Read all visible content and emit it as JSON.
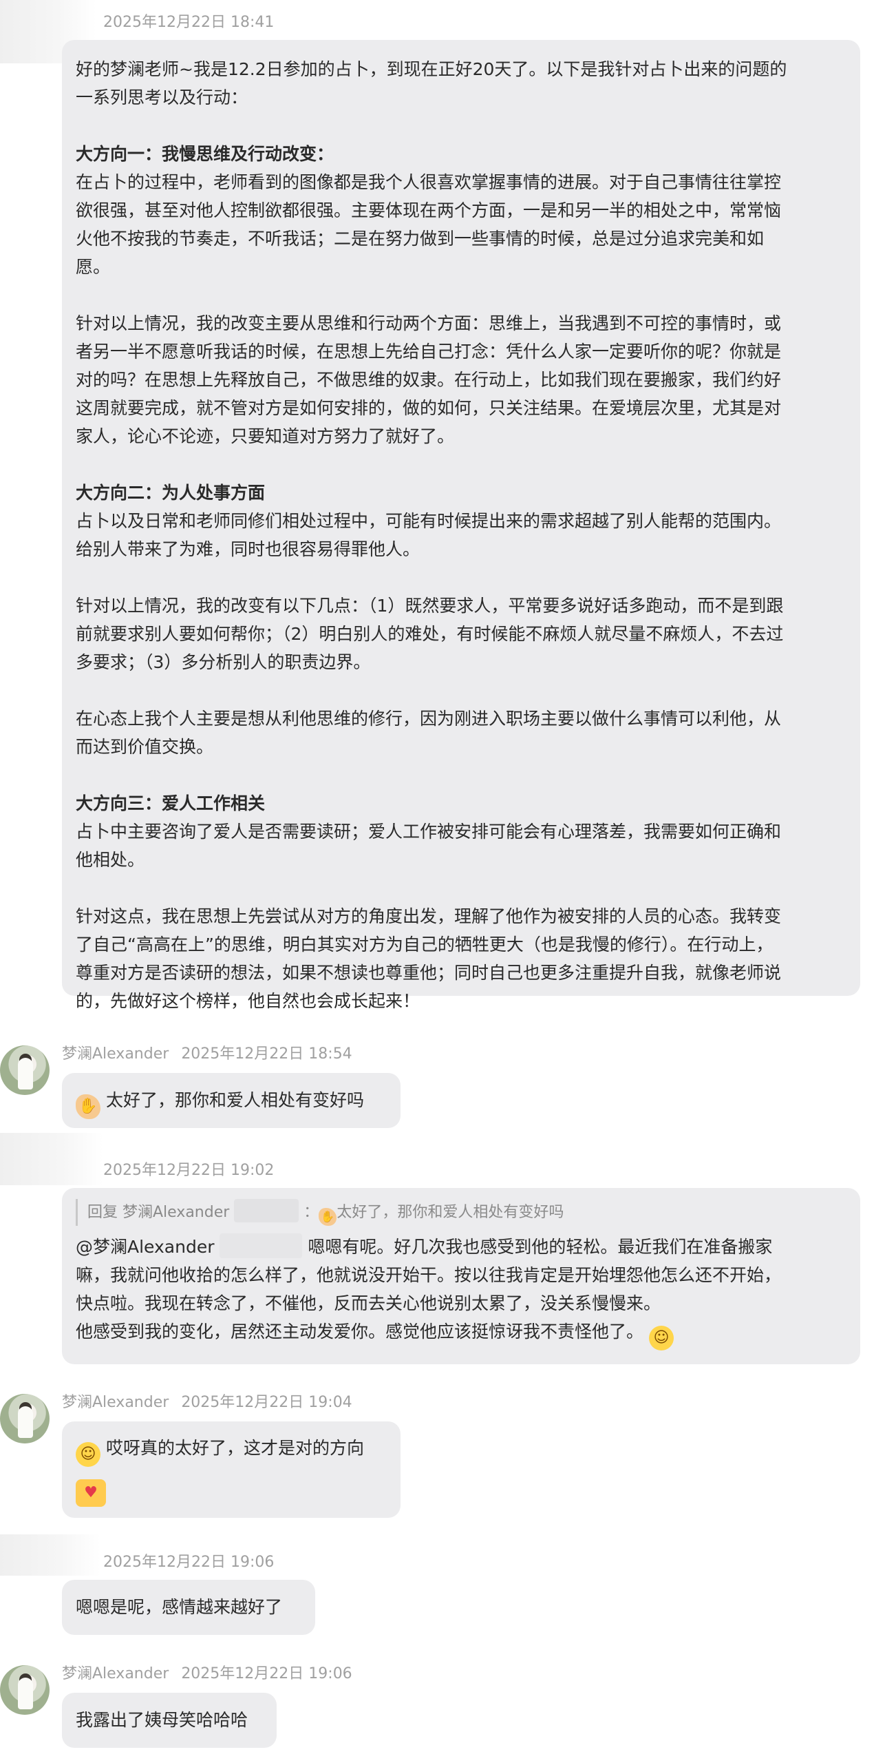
{
  "messages": [
    {
      "time": "2025年12月22日 18:41",
      "heading1_text": "好的梦澜老师~我是12.2日参加的占卜，到现在正好20天了。以下是我针对占卜出来的问题的",
      "heading2_text": "一系列思考以及行动：",
      "section1_title": "大方向一：我慢思维及行动改变：",
      "section1_lines": [
        "在占卜的过程中，老师看到的图像都是我个人很喜欢掌握事情的进展。对于自己事情往往掌控",
        "欲很强，甚至对他人控制欲都很强。主要体现在两个方面，一是和另一半的相处之中，常常恼",
        "火他不按我的节奏走，不听我话；二是在努力做到一些事情的时候，总是过分追求完美和如",
        "愿。"
      ],
      "section1b_lines": [
        "针对以上情况，我的改变主要从思维和行动两个方面：思维上，当我遇到不可控的事情时，或",
        "者另一半不愿意听我话的时候，在思想上先给自己打念：凭什么人家一定要听你的呢？你就是",
        "对的吗？在思想上先释放自己，不做思维的奴隶。在行动上，比如我们现在要搬家，我们约好",
        "这周就要完成，就不管对方是如何安排的，做的如何，只关注结果。在爱境层次里，尤其是对",
        "家人，论心不论迹，只要知道对方努力了就好了。"
      ],
      "section2_title": "大方向二：为人处事方面",
      "section2_lines": [
        "占卜以及日常和老师同修们相处过程中，可能有时候提出来的需求超越了别人能帮的范围内。",
        "给别人带来了为难，同时也很容易得罪他人。"
      ],
      "section2b_lines": [
        "针对以上情况，我的改变有以下几点：（1）既然要求人，平常要多说好话多跑动，而不是到跟",
        "前就要求别人要如何帮你；（2）明白别人的难处，有时候能不麻烦人就尽量不麻烦人，不去过",
        "多要求；（3）多分析别人的职责边界。"
      ],
      "section2c_lines": [
        "在心态上我个人主要是想从利他思维的修行，因为刚进入职场主要以做什么事情可以利他，从",
        "而达到价值交换。"
      ],
      "section3_title": "大方向三：爱人工作相关",
      "section3_lines": [
        "占卜中主要咨询了爱人是否需要读研；爱人工作被安排可能会有心理落差，我需要如何正确和",
        "他相处。"
      ],
      "section3b_lines": [
        "针对这点，我在思想上先尝试从对方的角度出发，理解了他作为被安排的人员的心态。我转变",
        "了自己“高高在上”的思维，明白其实对方为自己的牺牲更大（也是我慢的修行）。在行动上，",
        "尊重对方是否读研的想法，如果不想读也尊重他；同时自己也更多注重提升自我，就像老师说",
        "的，先做好这个榜样，他自然也会成长起来！"
      ]
    }
  ],
  "reply1": {
    "name": "梦澜Alexander",
    "time": "2025年12月22日 18:54",
    "text": "太好了，那你和爱人相处有变好吗",
    "emoji": "clapping-hands"
  },
  "msg2": {
    "time": "2025年12月22日 19:02",
    "quote_prefix": "回复 梦澜Alexander",
    "quote_suffix": "：",
    "quote_text": "太好了，那你和爱人相处有变好吗",
    "mention": "@梦澜Alexander",
    "line1_tail": "嗯嗯有呢。好几次我也感受到他的轻松。最近我们在准备搬家",
    "lines": [
      "嘛，我就问他收拾的怎么样了，他就说没开始干。按以往我肯定是开始埋怨他怎么还不开始，",
      "快点啦。我现在转念了，不催他，反而去关心他说别太累了，没关系慢慢来。",
      "他感受到我的变化，居然还主动发爱你。感觉他应该挺惊讶我不责怪他了。"
    ]
  },
  "reply2": {
    "name": "梦澜Alexander",
    "time": "2025年12月22日 19:04",
    "text": "哎呀真的太好了，这才是对的方向"
  },
  "msg3": {
    "time": "2025年12月22日 19:06",
    "text": "嗯嗯是呢，感情越来越好了"
  },
  "reply3": {
    "name": "梦澜Alexander",
    "time": "2025年12月22日 19:06",
    "text": "我露出了姨母笑哈哈哈"
  },
  "colors": {
    "bubble": "#ececee",
    "meta_text": "#a0a0a0",
    "body_text": "#2a2a2a"
  }
}
